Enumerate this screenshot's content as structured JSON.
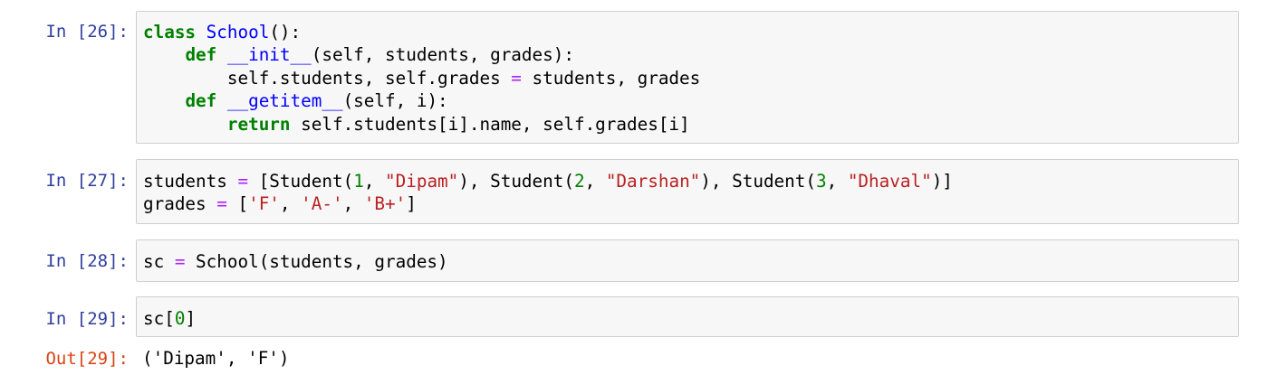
{
  "cells": [
    {
      "prompt": "In [26]:",
      "lines": [
        [
          [
            "class",
            "kw"
          ],
          [
            " ",
            "plain"
          ],
          [
            "School",
            "cls"
          ],
          [
            "():",
            "plain"
          ]
        ],
        [
          [
            "    ",
            "plain"
          ],
          [
            "def",
            "kw"
          ],
          [
            " ",
            "plain"
          ],
          [
            "__init__",
            "fn"
          ],
          [
            "(self, students, grades):",
            "plain"
          ]
        ],
        [
          [
            "        self.students, self.grades ",
            "plain"
          ],
          [
            "=",
            "op"
          ],
          [
            " students, grades",
            "plain"
          ]
        ],
        [
          [
            "    ",
            "plain"
          ],
          [
            "def",
            "kw"
          ],
          [
            " ",
            "plain"
          ],
          [
            "__getitem__",
            "fn"
          ],
          [
            "(self, i):",
            "plain"
          ]
        ],
        [
          [
            "        ",
            "plain"
          ],
          [
            "return",
            "kw"
          ],
          [
            " self.students[i].name, self.grades[i]",
            "plain"
          ]
        ]
      ]
    },
    {
      "prompt": "In [27]:",
      "lines": [
        [
          [
            "students ",
            "plain"
          ],
          [
            "=",
            "op"
          ],
          [
            " [Student(",
            "plain"
          ],
          [
            "1",
            "num"
          ],
          [
            ", ",
            "plain"
          ],
          [
            "\"Dipam\"",
            "str"
          ],
          [
            "), Student(",
            "plain"
          ],
          [
            "2",
            "num"
          ],
          [
            ", ",
            "plain"
          ],
          [
            "\"Darshan\"",
            "str"
          ],
          [
            "), Student(",
            "plain"
          ],
          [
            "3",
            "num"
          ],
          [
            ", ",
            "plain"
          ],
          [
            "\"Dhaval\"",
            "str"
          ],
          [
            ")]",
            "plain"
          ]
        ],
        [
          [
            "grades ",
            "plain"
          ],
          [
            "=",
            "op"
          ],
          [
            " [",
            "plain"
          ],
          [
            "'F'",
            "str"
          ],
          [
            ", ",
            "plain"
          ],
          [
            "'A-'",
            "str"
          ],
          [
            ", ",
            "plain"
          ],
          [
            "'B+'",
            "str"
          ],
          [
            "]",
            "plain"
          ]
        ]
      ]
    },
    {
      "prompt": "In [28]:",
      "lines": [
        [
          [
            "sc ",
            "plain"
          ],
          [
            "=",
            "op"
          ],
          [
            " School(students, grades)",
            "plain"
          ]
        ]
      ]
    },
    {
      "prompt": "In [29]:",
      "lines": [
        [
          [
            "sc[",
            "plain"
          ],
          [
            "0",
            "num"
          ],
          [
            "]",
            "plain"
          ]
        ]
      ],
      "output_prompt": "Out[29]:",
      "output_text": "('Dipam', 'F')"
    }
  ],
  "colors": {
    "keyword": "#008000",
    "class_name": "#0000ff",
    "function_name": "#0000ff",
    "operator": "#aa22ff",
    "number": "#008000",
    "string": "#ba2121",
    "in_prompt": "#303f9f",
    "out_prompt": "#d84315",
    "cell_background": "#f7f7f7",
    "cell_border": "#cfcfcf"
  }
}
